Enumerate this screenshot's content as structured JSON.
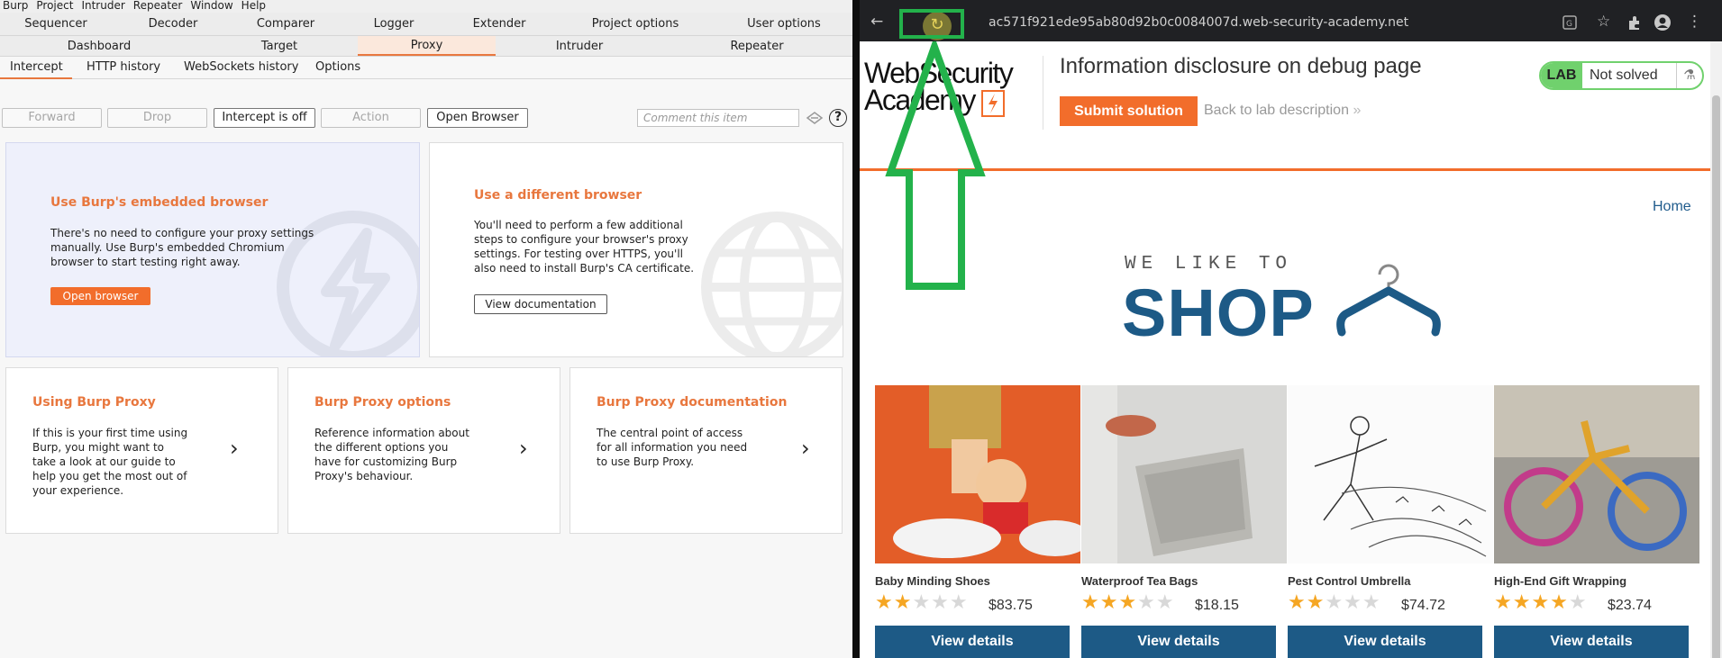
{
  "burp": {
    "menu": [
      "Burp",
      "Project",
      "Intruder",
      "Repeater",
      "Window",
      "Help"
    ],
    "row1_tabs": [
      "Sequencer",
      "Decoder",
      "Comparer",
      "Logger",
      "Extender",
      "Project options",
      "User options"
    ],
    "row2_tabs": [
      "Dashboard",
      "Target",
      "Proxy",
      "Intruder",
      "Repeater"
    ],
    "sub_tabs": [
      "Intercept",
      "HTTP history",
      "WebSockets history",
      "Options"
    ],
    "toolbar": {
      "forward": "Forward",
      "drop": "Drop",
      "intercept": "Intercept is off",
      "action": "Action",
      "open_browser": "Open Browser",
      "comment_placeholder": "Comment this item",
      "help": "?"
    },
    "cards": {
      "embedded": {
        "title": "Use Burp's embedded browser",
        "text": "There's no need to configure your proxy settings manually. Use Burp's embedded Chromium browser to start testing right away.",
        "button": "Open browser"
      },
      "different": {
        "title": "Use a different browser",
        "text": "You'll need to perform a few additional steps to configure your browser's proxy settings. For testing over HTTPS, you'll also need to install Burp's CA certificate.",
        "button": "View documentation"
      },
      "using": {
        "title": "Using Burp Proxy",
        "text": "If this is your first time using Burp, you might want to take a look at our guide to help you get the most out of your experience."
      },
      "options": {
        "title": "Burp Proxy options",
        "text": "Reference information about the different options you have for customizing Burp Proxy's behaviour."
      },
      "docs": {
        "title": "Burp Proxy documentation",
        "text": "The central point of access for all information you need to use Burp Proxy."
      }
    }
  },
  "browser": {
    "url": "ac571f921ede95ab80d92b0c0084007d.web-security-academy.net",
    "logo": [
      "Web",
      "Security",
      "Academy"
    ],
    "lab_title": "Information disclosure on debug page",
    "submit": "Submit solution",
    "back": "Back to lab description",
    "lab_label": "LAB",
    "status": "Not solved",
    "home": "Home",
    "banner_small": "WE LIKE TO",
    "banner_big": "SHOP",
    "products": [
      {
        "name": "Baby Minding Shoes",
        "rating": 2,
        "price": "$83.75",
        "button": "View details"
      },
      {
        "name": "Waterproof Tea Bags",
        "rating": 3,
        "price": "$18.15",
        "button": "View details"
      },
      {
        "name": "Pest Control Umbrella",
        "rating": 2,
        "price": "$74.72",
        "button": "View details"
      },
      {
        "name": "High-End Gift Wrapping",
        "rating": 4,
        "price": "$23.74",
        "button": "View details"
      }
    ],
    "colors": {
      "accent": "#f26d2b",
      "brand_blue": "#1d5a86",
      "lab_green": "#70d16d",
      "annotation_green": "#23b24b"
    }
  }
}
